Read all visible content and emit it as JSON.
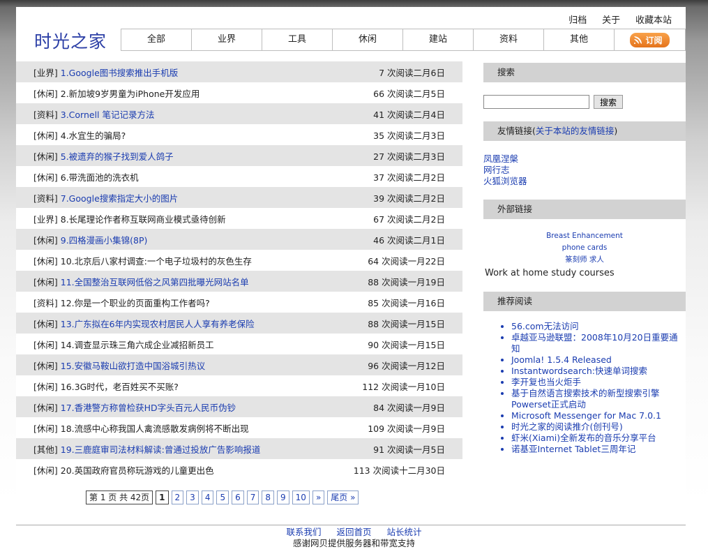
{
  "top_links": [
    "归档",
    "关于",
    "收藏本站"
  ],
  "logo": "时光之家",
  "nav": [
    "全部",
    "业界",
    "工具",
    "休闲",
    "建站",
    "资料",
    "其他"
  ],
  "rss_label": "订阅",
  "articles": [
    {
      "cat": "[业界]",
      "title": "1.Google图书搜索推出手机版",
      "meta": "7 次阅读二月6日"
    },
    {
      "cat": "[休闲]",
      "title": "2.新加坡9岁男童为iPhone开发应用",
      "meta": "66 次阅读二月5日"
    },
    {
      "cat": "[资料]",
      "title": "3.Cornell 笔记记录方法",
      "meta": "41 次阅读二月4日"
    },
    {
      "cat": "[休闲]",
      "title": "4.水宜生的骗局?",
      "meta": "35 次阅读二月3日"
    },
    {
      "cat": "[休闲]",
      "title": "5.被遗弃的猴子找到爱人鸽子",
      "meta": "27 次阅读二月3日"
    },
    {
      "cat": "[休闲]",
      "title": "6.带洗面池的洗衣机",
      "meta": "37 次阅读二月2日"
    },
    {
      "cat": "[资料]",
      "title": "7.Google搜索指定大小的图片",
      "meta": "39 次阅读二月2日"
    },
    {
      "cat": "[业界]",
      "title": "8.长尾理论作者称互联网商业模式亟待创新",
      "meta": "67 次阅读二月2日"
    },
    {
      "cat": "[休闲]",
      "title": "9.四格漫画小集锦(8P)",
      "meta": "46 次阅读二月1日"
    },
    {
      "cat": "[休闲]",
      "title": "10.北京后八家村调查:一个电子垃圾村的灰色生存",
      "meta": "64 次阅读一月22日"
    },
    {
      "cat": "[休闲]",
      "title": "11.全国整治互联网低俗之风第四批曝光网站名单",
      "meta": "88 次阅读一月19日"
    },
    {
      "cat": "[资料]",
      "title": "12.你是一个职业的页面重构工作者吗?",
      "meta": "85 次阅读一月16日"
    },
    {
      "cat": "[休闲]",
      "title": "13.广东拟在6年内实现农村居民人人享有养老保险",
      "meta": "88 次阅读一月15日"
    },
    {
      "cat": "[休闲]",
      "title": "14.调查显示珠三角六成企业减招新员工",
      "meta": "90 次阅读一月15日"
    },
    {
      "cat": "[休闲]",
      "title": "15.安徽马鞍山欲打造中国浴城引热议",
      "meta": "96 次阅读一月12日"
    },
    {
      "cat": "[休闲]",
      "title": "16.3G时代，老百姓买不买账?",
      "meta": "112 次阅读一月10日"
    },
    {
      "cat": "[休闲]",
      "title": "17.香港警方称曾检获HD字头百元人民币伪钞",
      "meta": "84 次阅读一月9日"
    },
    {
      "cat": "[休闲]",
      "title": "18.流感中心称我国人禽流感散发病例将不断出现",
      "meta": "109 次阅读一月9日"
    },
    {
      "cat": "[其他]",
      "title": "19.三鹿庭审司法材料解读:曾通过投放广告影响报道",
      "meta": "91 次阅读一月5日"
    },
    {
      "cat": "[休闲]",
      "title": "20.英国政府官员称玩游戏的儿童更出色",
      "meta": "113 次阅读十二月30日"
    }
  ],
  "pager": {
    "info": "第 1 页 共 42页",
    "current": "1",
    "pages": [
      "2",
      "3",
      "4",
      "5",
      "6",
      "7",
      "8",
      "9",
      "10"
    ],
    "next": "»",
    "last": "尾页 »"
  },
  "sidebar": {
    "search_head": "搜索",
    "search_button": "搜索",
    "friends_head": "友情链接(",
    "friends_head_link": "关于本站的友情链接",
    "friends_head_close": ")",
    "friends": [
      "凤凰涅槃",
      "网行志",
      "火狐浏览器"
    ],
    "external_head": "外部链接",
    "external": [
      "Breast Enhancement",
      "phone cards",
      "篆刻师 求人"
    ],
    "external_text": "Work at home study courses",
    "recommend_head": "推荐阅读",
    "recommend": [
      "56.com无法访问",
      "卓越亚马逊联盟：2008年10月20日重要通知",
      "Joomla! 1.5.4 Released",
      "Instantwordsearch:快速单词搜索",
      "李开复也当火炬手",
      "基于自然语言搜索技术的新型搜索引擎Powerset正式启动",
      "Microsoft Messenger for Mac 7.0.1",
      "时光之家的阅读推介(创刊号)",
      "虾米(Xiami)全新发布的音乐分享平台",
      "诺基亚Internet Tablet三周年记"
    ]
  },
  "footer": {
    "links": [
      "联系我们",
      "返回首页",
      "站长统计"
    ],
    "thanks": "感谢网贝提供服务器和带宽支持"
  }
}
